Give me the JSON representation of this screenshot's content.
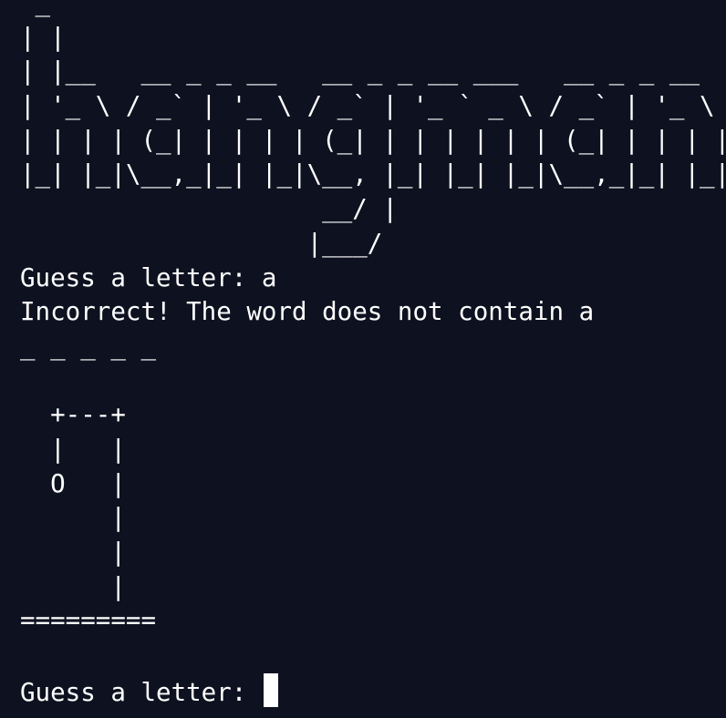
{
  "terminal": {
    "banner": [
      " _",
      "| |",
      "| |__   __ _ _ __   __ _ _ __ ___   __ _ _ __",
      "| '_ \\ / _` | '_ \\ / _` | '_ ` _ \\ / _` | '_ \\",
      "| | | | (_| | | | | (_| | | | | | | (_| | | | |",
      "|_| |_|\\__,_|_| |_|\\__, |_| |_| |_|\\__,_|_| |_|",
      "                    __/ |",
      "                   |___/"
    ],
    "guess_prompt_1": "Guess a letter: ",
    "guess_input_1": "a",
    "feedback": "Incorrect! The word does not contain a",
    "word_display": "_ _ _ _ _",
    "blank_1": "",
    "gallows": [
      "  +---+",
      "  |   |",
      "  O   |",
      "      |",
      "      |",
      "      |",
      "========="
    ],
    "blank_2": "",
    "current_prompt": "Guess a letter: ",
    "current_input": ""
  },
  "colors": {
    "background": "#0e1220",
    "foreground": "#ffffff",
    "cursor": "#ffffff"
  }
}
